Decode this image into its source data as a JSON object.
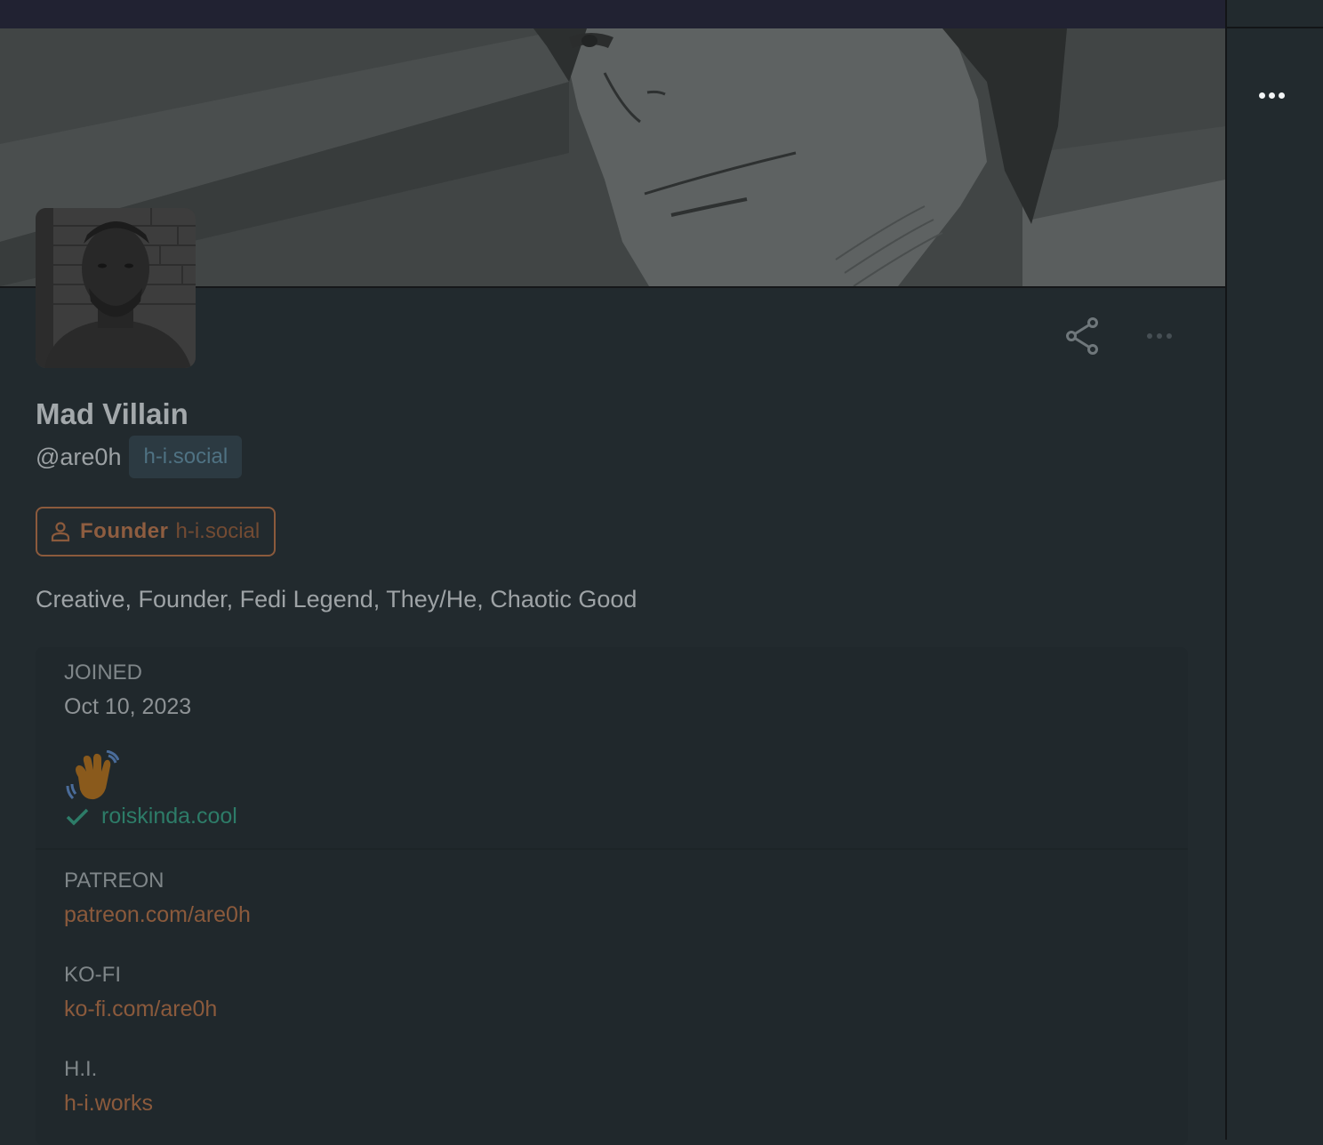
{
  "profile": {
    "display_name": "Mad Villain",
    "handle": "@are0h",
    "instance": "h-i.social",
    "bio": "Creative, Founder, Fedi Legend, They/He, Chaotic Good"
  },
  "role_badge": {
    "icon": "person-icon",
    "name": "Founder",
    "domain": "h-i.social"
  },
  "actions": {
    "share_icon": "share-icon",
    "more_icon": "more-dots-icon"
  },
  "joined": {
    "label": "JOINED",
    "date": "Oct 10, 2023"
  },
  "verified_field": {
    "emoji": "waving-hand",
    "link": "roiskinda.cool"
  },
  "fields": [
    {
      "label": "PATREON",
      "value": "patreon.com/are0h"
    },
    {
      "label": "KO-FI",
      "value": "ko-fi.com/are0h"
    },
    {
      "label": "H.I.",
      "value": "h-i.works"
    }
  ],
  "colors": {
    "background": "#222a2e",
    "link": "#8b5a3c",
    "verified": "#2d7c68",
    "instance_chip": "#2c3a42"
  }
}
